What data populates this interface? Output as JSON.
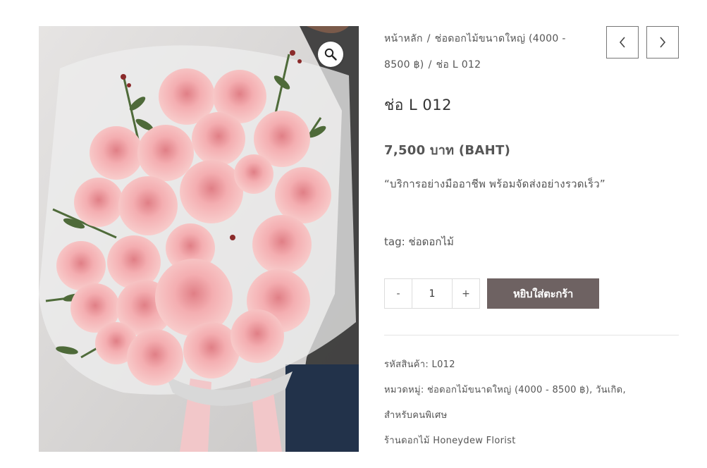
{
  "product": {
    "image_alt": "ช่อดอกกุหลาบสีชมพู",
    "breadcrumb": {
      "home": "หน้าหลัก",
      "separator": "/",
      "category": "ช่อดอกไม้ขนาดใหญ่ (4000 - 8500 ฿)",
      "current": "ช่อ L 012"
    },
    "title": "ช่อ L 012",
    "price": "7,500 บาท (BAHT)",
    "short_description": "“บริการอย่างมืออาชีพ พร้อมจัดส่งอย่างรวดเร็ว”",
    "tag_label": "tag:",
    "tag_value": "ช่อดอกไม้",
    "quantity": {
      "minus": "-",
      "value": "1",
      "plus": "+"
    },
    "add_to_cart_label": "หยิบใส่ตะกร้า",
    "meta": {
      "sku_label": "รหัสสินค้า:",
      "sku_value": "L012",
      "category_label": "หมวดหมู่:",
      "categories": [
        "ช่อดอกไม้ขนาดใหญ่ (4000 - 8500 ฿)",
        "วันเกิด",
        "สำหรับคนพิเศษ"
      ],
      "shop_label": "ร้านดอกไม้",
      "shop_name": "Honeydew Florist"
    }
  },
  "icons": {
    "zoom": "magnifier-icon",
    "prev": "chevron-left-icon",
    "next": "chevron-right-icon"
  },
  "colors": {
    "cart_button": "#6e6262",
    "text": "#555555",
    "rose": "#f2a9ac"
  }
}
